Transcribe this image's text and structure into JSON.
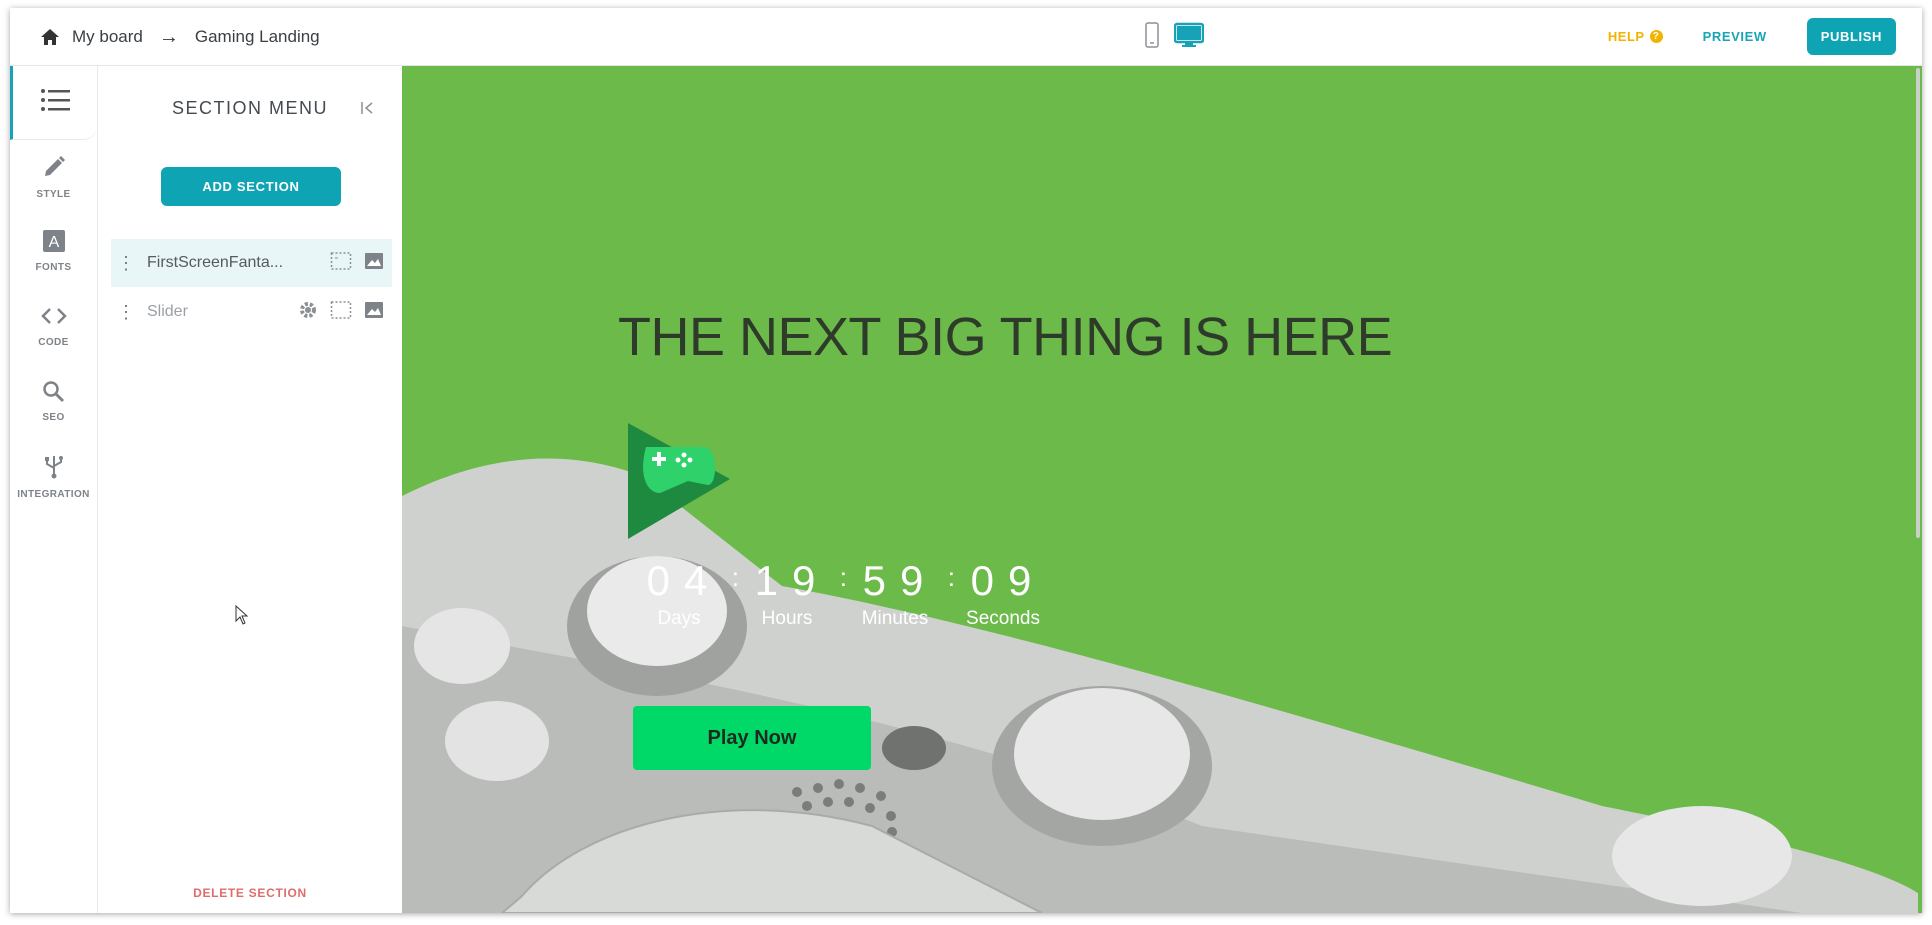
{
  "breadcrumb": {
    "home_icon": "home-icon",
    "board": "My board",
    "separator": "→",
    "page": "Gaming Landing"
  },
  "devices": {
    "mobile_icon": "mobile-icon",
    "desktop_icon": "desktop-icon",
    "active": "desktop"
  },
  "actions": {
    "help": "HELP",
    "preview": "PREVIEW",
    "publish": "PUBLISH"
  },
  "rail": {
    "items": [
      {
        "label": "STYLE",
        "icon": "pencil-icon"
      },
      {
        "label": "FONTS",
        "icon": "font-icon"
      },
      {
        "label": "CODE",
        "icon": "code-icon"
      },
      {
        "label": "SEO",
        "icon": "search-icon"
      },
      {
        "label": "INTEGRATION",
        "icon": "usb-icon"
      }
    ]
  },
  "panel": {
    "title": "SECTION MENU",
    "add_label": "ADD SECTION",
    "sections": [
      {
        "name": "FirstScreenFanta..."
      },
      {
        "name": "Slider"
      }
    ],
    "delete_label": "DELETE SECTION"
  },
  "hero": {
    "headline": "THE NEXT BIG THING IS HERE",
    "countdown": [
      {
        "value": "04",
        "label": "Days"
      },
      {
        "value": "19",
        "label": "Hours"
      },
      {
        "value": "59",
        "label": "Minutes"
      },
      {
        "value": "09",
        "label": "Seconds"
      }
    ],
    "cta": "Play Now"
  },
  "colors": {
    "accent": "#0fa4b4",
    "hero_bg": "#6cba4a",
    "cta": "#00d967",
    "help": "#f2b300",
    "delete": "#e06b6b"
  }
}
